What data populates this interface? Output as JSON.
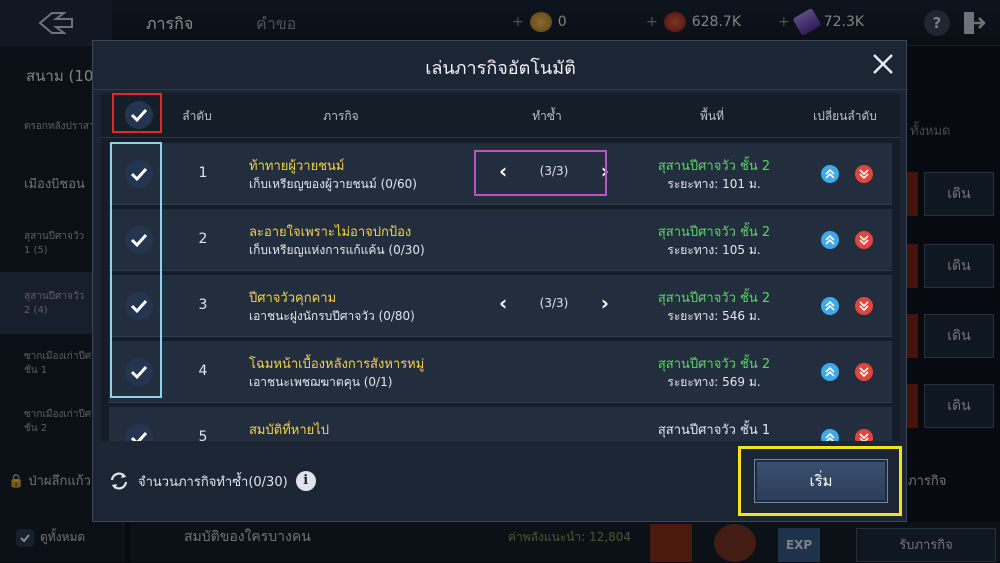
{
  "topbar": {
    "tabs": [
      "ภารกิจ",
      "คำขอ"
    ],
    "currencies": [
      {
        "icon": "gold-coin-icon",
        "value": "0",
        "color": "#d9a63b"
      },
      {
        "icon": "copper-coin-icon",
        "value": "628.7K",
        "color": "#c0392b"
      },
      {
        "icon": "purple-crystal-icon",
        "value": "72.3K",
        "color": "#7b4fc9"
      }
    ],
    "help": "?"
  },
  "left_panel": {
    "title": "สนาม (10",
    "items": [
      "ตรอกหลังปราสาท",
      "เมืองบิชอน",
      "สุสานปีศาจวัว",
      "1 (5)",
      "สุสานปีศาจวัว",
      "2 (4)",
      "ซากเมืองเก่าปีศาจ",
      "ชั้น 1",
      "ซากเมืองเก่าปีศาจ",
      "ชั้น 2"
    ],
    "lock_label": "ป่าผลึกแก้ว",
    "check_all_label": "ดูทั้งหมด"
  },
  "background": {
    "buttons": [
      "เดิน",
      "เดิน",
      "เดิน",
      "เดิน"
    ],
    "all_label": "ทั้งหมด",
    "quest_label": "ภารกิจ",
    "receive_label": "รับภารกิจ",
    "bottom_item": "สมบัติของใครบางคน",
    "recommended_power": "ค่าพลังแนะนำ: 12,804",
    "exp_badge": "EXP"
  },
  "dialog": {
    "title": "เล่นภารกิจอัตโนมัติ",
    "headers": {
      "order": "ลำดับ",
      "quest": "ภารกิจ",
      "repeat": "ทำซ้ำ",
      "area": "พื้นที่",
      "reorder": "เปลี่ยนลำดับ"
    },
    "rows": [
      {
        "num": "1",
        "name": "ท้าทายผู้วายชนม์",
        "task": "เก็บเหรียญของผู้วายชนม์ (0/60)",
        "repeat": "(3/3)",
        "location": "สุสานปีศาจวัว ชั้น 2",
        "distance": "ระยะทาง: 101 ม."
      },
      {
        "num": "2",
        "name": "ละอายใจเพราะไม่อาจปกป้อง",
        "task": "เก็บเหรียญแห่งการแก้แค้น (0/30)",
        "repeat": "",
        "location": "สุสานปีศาจวัว ชั้น 2",
        "distance": "ระยะทาง: 105 ม."
      },
      {
        "num": "3",
        "name": "ปีศาจวัวคุกคาม",
        "task": "เอาชนะฝูงนักรบปีศาจวัว (0/80)",
        "repeat": "(3/3)",
        "location": "สุสานปีศาจวัว ชั้น 2",
        "distance": "ระยะทาง: 546 ม."
      },
      {
        "num": "4",
        "name": "โฉมหน้าเบื้องหลังการสังหารหมู่",
        "task": "เอาชนะเพชฌฆาตคุน (0/1)",
        "repeat": "",
        "location": "สุสานปีศาจวัว ชั้น 2",
        "distance": "ระยะทาง: 569 ม."
      },
      {
        "num": "5",
        "name": "สมบัติที่หายไป",
        "task": "",
        "repeat": "",
        "location": "สุสานปีศาจวัว ชั้น 1",
        "distance": ""
      }
    ],
    "repeat_count_label": "จำนวนภารกิจทำซ้ำ(0/30)",
    "start_label": "เริ่ม"
  },
  "colors": {
    "location_green": "#5fd36a",
    "quest_yellow": "#f2d24a",
    "highlight_red": "#e8262a",
    "highlight_blue": "#8fd0ea",
    "highlight_purple": "#b358c0",
    "highlight_yellow": "#f2e41b"
  }
}
